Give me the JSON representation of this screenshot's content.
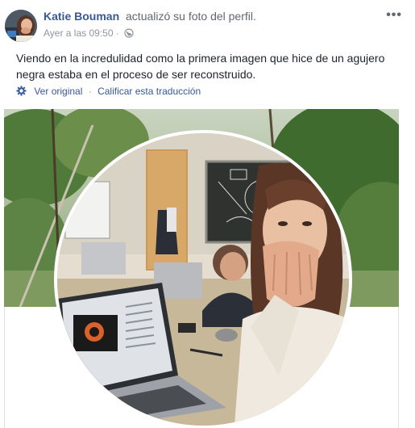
{
  "post": {
    "author_name": "Katie Bouman",
    "action_text": "actualizó su foto del perfil.",
    "timestamp": "Ayer a las 09:50",
    "separator": "·",
    "more_label": "•••",
    "body_text": "Viendo en la incredulidad como la primera imagen que hice de un agujero negra estaba en el proceso de ser reconstruido.",
    "translation": {
      "see_original": "Ver original",
      "separator": "·",
      "rate_translation": "Calificar esta traducción"
    }
  },
  "colors": {
    "link": "#385898",
    "meta": "#90949c",
    "text": "#1d2129"
  },
  "icons": {
    "privacy": "globe-icon",
    "translation": "gear-icon",
    "more": "more-options-icon"
  }
}
